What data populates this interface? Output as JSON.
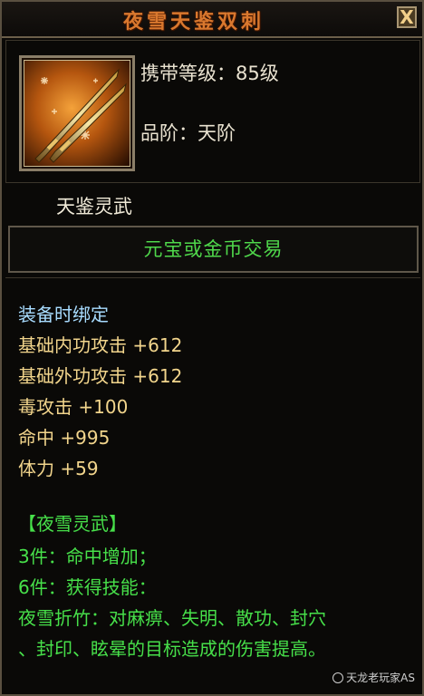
{
  "window": {
    "title": "夜雪天鉴双刺",
    "close_label": "X"
  },
  "item": {
    "icon": "dual-daggers-icon",
    "carry_level": "携带等级：85级",
    "grade": "品阶：天阶",
    "type": "天鉴灵武",
    "trade": "元宝或金币交易"
  },
  "attributes": {
    "bind": "装备时绑定",
    "stats": [
      "基础内功攻击 +612",
      "基础外功攻击 +612",
      "毒攻击 +100",
      "命中 +995",
      "体力 +59"
    ]
  },
  "set": {
    "title": "【夜雪灵武】",
    "lines": [
      "3件：命中增加；",
      "6件：获得技能：",
      "夜雪折竹：对麻痹、失明、散功、封穴",
      "、封印、眩晕的目标造成的伤害提高。"
    ]
  },
  "watermark": "天龙老玩家AS",
  "colors": {
    "title": "#d9782e",
    "trade_green": "#4fd84b",
    "bind_blue": "#a8dcff",
    "stat_yellow": "#f2d58c",
    "set_green": "#47e04a"
  }
}
